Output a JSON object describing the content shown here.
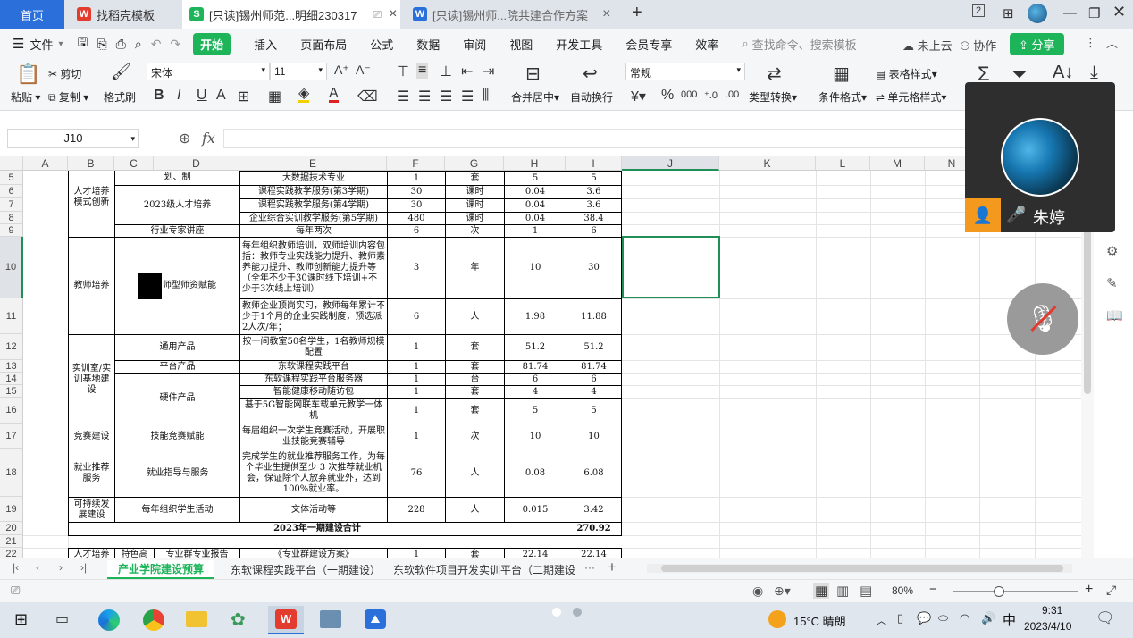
{
  "tabs": [
    {
      "label": "首页"
    },
    {
      "label": "找稻壳模板",
      "icon": "wps-icon"
    },
    {
      "label": "[只读]锡州师范...明细230317",
      "icon": "sheet-icon"
    },
    {
      "label": "[只读]锡州师...院共建合作方案",
      "icon": "doc-icon"
    }
  ],
  "window": {
    "new_tab": "+",
    "badge": "2"
  },
  "menu": {
    "file": "文件",
    "items": [
      "开始",
      "插入",
      "页面布局",
      "公式",
      "数据",
      "审阅",
      "视图",
      "开发工具",
      "会员专享",
      "效率"
    ],
    "search_placeholder": "查找命令、搜索模板",
    "cloud": "未上云",
    "collab": "协作",
    "share": "分享"
  },
  "toolbar": {
    "paste": "粘贴",
    "cut": "剪切",
    "copy": "复制",
    "format_painter": "格式刷",
    "font_name": "宋体",
    "font_size": "11",
    "merge": "合并居中",
    "wrap": "自动换行",
    "number_format": "常规",
    "convert": "类型转换",
    "conditional": "条件格式",
    "table_style": "表格样式",
    "cell_style": "单元格样式"
  },
  "formula": {
    "name_box": "J10",
    "fx": "fx"
  },
  "columns": [
    "A",
    "B",
    "C",
    "D",
    "E",
    "F",
    "G",
    "H",
    "I",
    "J",
    "K",
    "L",
    "M",
    "N"
  ],
  "rows": [
    "5",
    "6",
    "7",
    "8",
    "9",
    "10",
    "11",
    "12",
    "13",
    "14",
    "15",
    "16",
    "17",
    "18",
    "19",
    "20",
    "21",
    "22"
  ],
  "cells": {
    "d4": "划、制",
    "b_talent": "人才培养模式创新",
    "cd_2023": "2023级人才培养",
    "cd_expert": "行业专家讲座",
    "e5": "大数据技术专业",
    "f5": "1",
    "g5": "套",
    "h5": "5",
    "i5": "5",
    "e6": "课程实践教学服务(第3学期)",
    "f6": "30",
    "g6": "课时",
    "h6": "0.04",
    "i6": "3.6",
    "e7": "课程实践教学服务(第4学期)",
    "f7": "30",
    "g7": "课时",
    "h7": "0.04",
    "i7": "3.6",
    "e8": "企业综合实训教学服务(第5学期)",
    "f8": "480",
    "g8": "课时",
    "h8": "0.04",
    "i8": "38.4",
    "e9": "每年两次",
    "f9": "6",
    "g9": "次",
    "h9": "1",
    "i9": "6",
    "b_teacher": "教师培养",
    "cd_teacher": "师型师资赋能",
    "e10": "每年组织教师培训，双师培训内容包括：教师专业实践能力提升、教师素养能力提升、教师创新能力提升等（全年不少于30课时线下培训+不少于3次线上培训）",
    "f10": "3",
    "g10": "年",
    "h10": "10",
    "i10": "30",
    "e11": "教师企业顶岗实习，教师每年累计不少于1个月的企业实践制度，预选派2人次/年；",
    "f11": "6",
    "g11": "人",
    "h11": "1.98",
    "i11": "11.88",
    "b_lab": "实训室/实训基地建设",
    "cd12": "通用产品",
    "e12": "按一间教室50名学生，1名教师规模配置",
    "f12": "1",
    "g12": "套",
    "h12": "51.2",
    "i12": "51.2",
    "cd13": "平台产品",
    "e13": "东软课程实践平台",
    "f13": "1",
    "g13": "套",
    "h13": "81.74",
    "i13": "81.74",
    "cd_hw": "硬件产品",
    "e14": "东软课程实践平台服务器",
    "f14": "1",
    "g14": "台",
    "h14": "6",
    "i14": "6",
    "e15": "智能健康移动随访包",
    "f15": "1",
    "g15": "套",
    "h15": "4",
    "i15": "4",
    "e16": "基于5G智能网联车载单元教学一体机",
    "f16": "1",
    "g16": "套",
    "h16": "5",
    "i16": "5",
    "b17": "竞赛建设",
    "cd17": "技能竞赛赋能",
    "e17": "每届组织一次学生竞赛活动，开展职业技能竞赛辅导",
    "f17": "1",
    "g17": "次",
    "h17": "10",
    "i17": "10",
    "b18": "就业推荐服务",
    "cd18": "就业指导与服务",
    "e18": "完成学生的就业推荐服务工作，为每个毕业生提供至少 3 次推荐就业机会，保证除个人放弃就业外，达到100%就业率。",
    "f18": "76",
    "g18": "人",
    "h18": "0.08",
    "i18": "6.08",
    "b19": "可持续发展建设",
    "cd19": "每年组织学生活动",
    "e19": "文体活动等",
    "f19": "228",
    "g19": "人",
    "h19": "0.015",
    "i19": "3.42",
    "total_label": "2023年一期建设合计",
    "total": "270.92",
    "b22": "人才培养",
    "c22": "特色高",
    "d22": "专业群专业报告",
    "e22": "《专业群建设方案》",
    "f22": "1",
    "g22": "套",
    "h22": "22.14",
    "i22": "22.14"
  },
  "sheets": [
    "产业学院建设预算",
    "东软课程实践平台（一期建设）",
    "东软软件项目开发实训平台（二期建设"
  ],
  "sheet_more": "···",
  "status": {
    "zoom": "80%"
  },
  "meeting": {
    "name": "朱婷"
  },
  "taskbar": {
    "weather": "15°C  晴朗",
    "ime": "中",
    "time": "9:31",
    "date": "2023/4/10"
  }
}
